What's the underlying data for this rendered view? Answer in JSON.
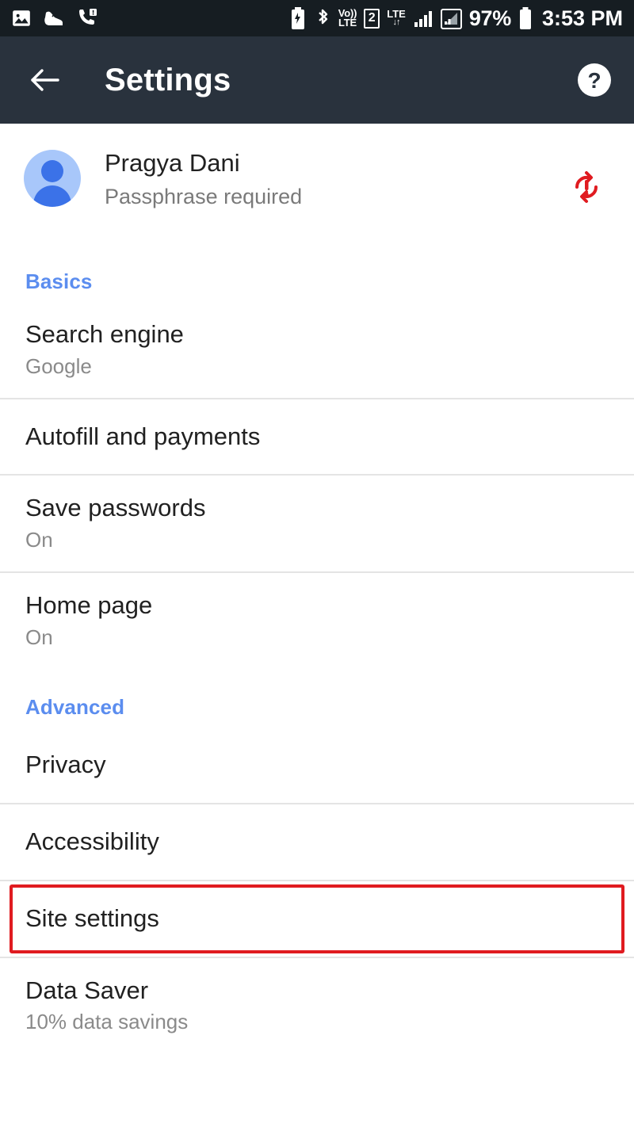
{
  "status_bar": {
    "left_icons": [
      "screenshot-icon",
      "shoe-icon",
      "missed-call-icon"
    ],
    "right_icons": [
      "battery-saver-icon",
      "bluetooth-icon",
      "volte-icon",
      "sim2-icon",
      "lte-data-icon",
      "signal-bars-icon",
      "signal-bars-2-icon",
      "battery-icon"
    ],
    "volte_top": "Vo))",
    "volte_bottom": "LTE",
    "sim_number": "2",
    "lte_label": "LTE",
    "lte_arrows": "↓↑",
    "battery_percent": "97%",
    "clock": "3:53 PM"
  },
  "app_bar": {
    "back_icon": "arrow-left-icon",
    "title": "Settings",
    "help_icon": "help-circle-icon",
    "background": "#29323d"
  },
  "account": {
    "avatar_icon": "person-avatar-icon",
    "name": "Pragya Dani",
    "status": "Passphrase required",
    "sync_icon": "sync-problem-icon",
    "sync_icon_color": "#e01b20"
  },
  "sections": [
    {
      "header": "Basics",
      "header_color": "#5b8def",
      "items": [
        {
          "title": "Search engine",
          "summary": "Google",
          "divided": false,
          "highlighted": false
        },
        {
          "title": "Autofill and payments",
          "summary": "",
          "divided": true,
          "highlighted": false
        },
        {
          "title": "Save passwords",
          "summary": "On",
          "divided": true,
          "highlighted": false
        },
        {
          "title": "Home page",
          "summary": "On",
          "divided": true,
          "highlighted": false
        }
      ]
    },
    {
      "header": "Advanced",
      "header_color": "#5b8def",
      "items": [
        {
          "title": "Privacy",
          "summary": "",
          "divided": false,
          "highlighted": false
        },
        {
          "title": "Accessibility",
          "summary": "",
          "divided": true,
          "highlighted": false
        },
        {
          "title": "Site settings",
          "summary": "",
          "divided": true,
          "highlighted": true
        },
        {
          "title": "Data Saver",
          "summary": "10% data savings",
          "divided": true,
          "highlighted": false
        }
      ]
    }
  ],
  "highlight": {
    "color": "#e01b20",
    "target": "Site settings"
  }
}
